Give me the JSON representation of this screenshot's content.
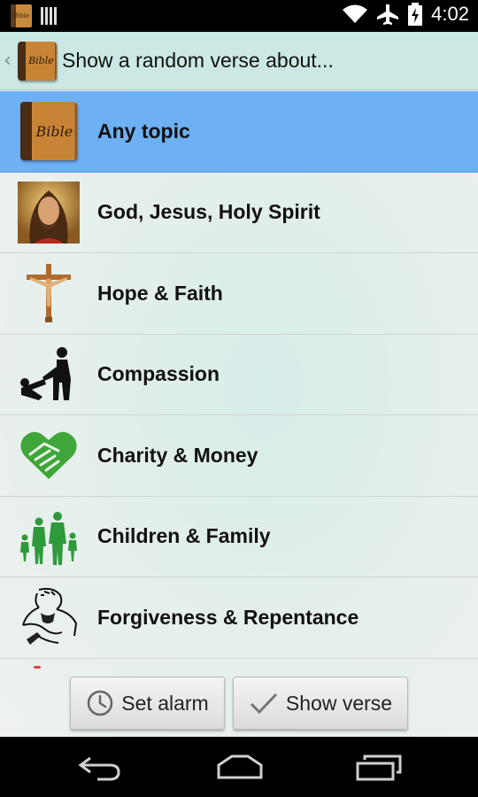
{
  "status_bar": {
    "time": "4:02",
    "icons": [
      "bible-notification-icon",
      "barcode-notification-icon",
      "wifi-icon",
      "airplane-mode-icon",
      "battery-charging-icon"
    ],
    "notification_icon_label": "Bible"
  },
  "action_bar": {
    "back_glyph": "‹",
    "app_icon_label": "Bible",
    "title": "Show a random verse about..."
  },
  "colors": {
    "action_bar_bg": "#cbe8e4",
    "selected_row_bg": "#6eb0f4",
    "list_bg": "#e4efec"
  },
  "topics": [
    {
      "label": "Any topic",
      "icon": "bible-book-icon",
      "icon_text": "Bible",
      "selected": true
    },
    {
      "label": "God, Jesus, Holy Spirit",
      "icon": "jesus-portrait-icon",
      "selected": false
    },
    {
      "label": "Hope & Faith",
      "icon": "crucifix-icon",
      "selected": false
    },
    {
      "label": "Compassion",
      "icon": "helping-hand-silhouette-icon",
      "selected": false
    },
    {
      "label": "Charity & Money",
      "icon": "heart-handshake-icon",
      "selected": false
    },
    {
      "label": "Children & Family",
      "icon": "family-silhouette-icon",
      "selected": false
    },
    {
      "label": "Forgiveness & Repentance",
      "icon": "embrace-sketch-icon",
      "selected": false
    }
  ],
  "buttons": {
    "set_alarm": "Set alarm",
    "show_verse": "Show verse"
  },
  "nav_bar": [
    "back-nav-icon",
    "home-nav-icon",
    "recents-nav-icon"
  ]
}
